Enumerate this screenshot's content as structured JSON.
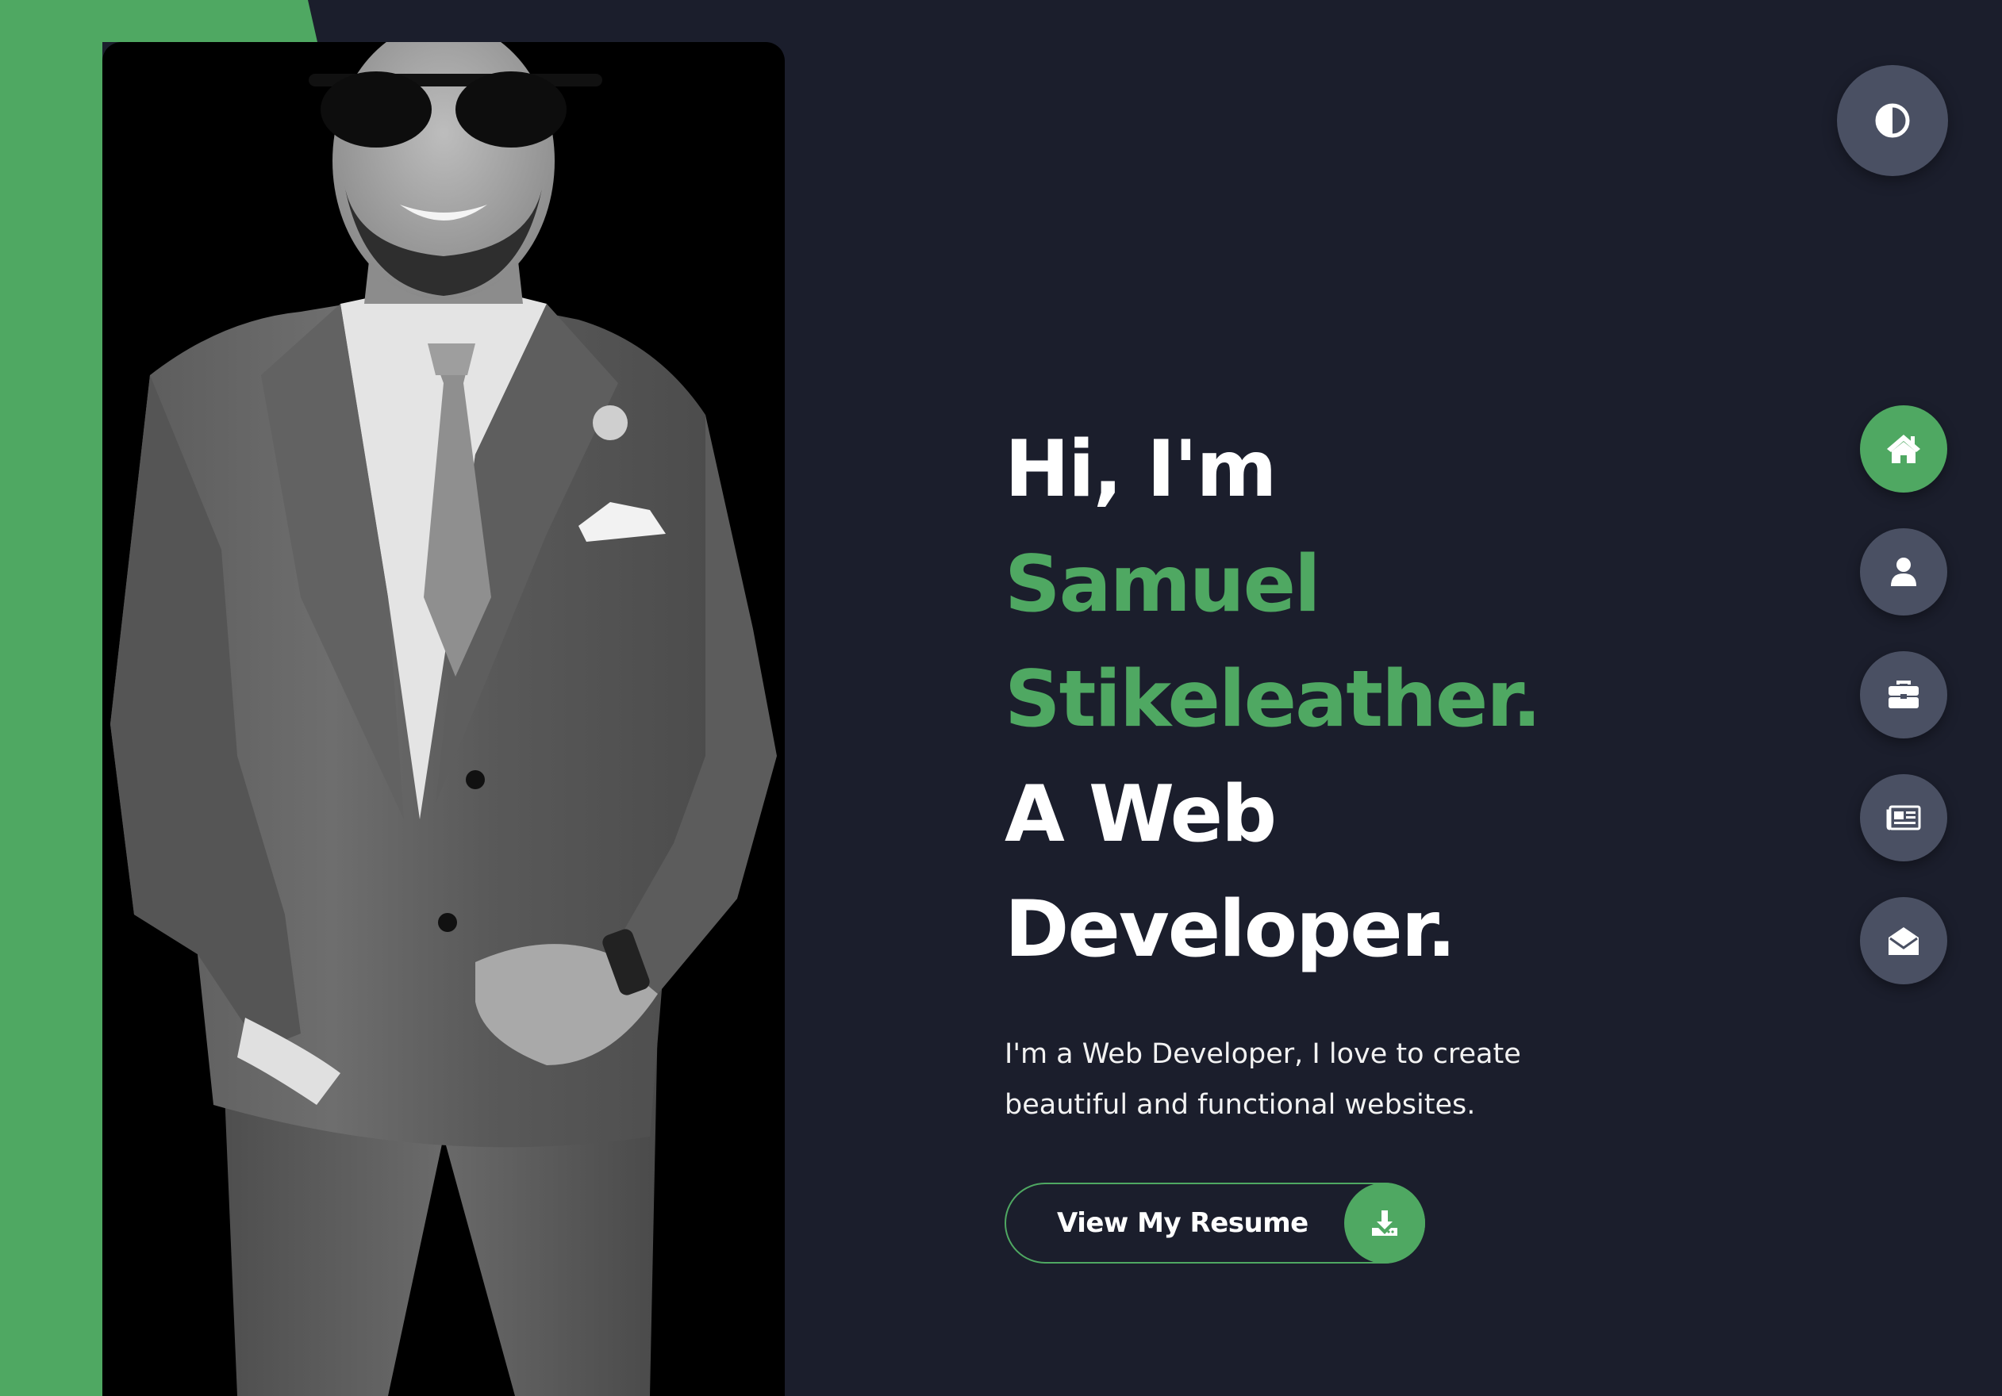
{
  "hero": {
    "greeting": "Hi, I'm",
    "name_first": "Samuel",
    "name_last": "Stikeleather.",
    "role_line1": "A Web",
    "role_line2": "Developer.",
    "intro_line1": "I'm a Web Developer, I love to create",
    "intro_line2": "beautiful and functional websites.",
    "resume_button_label": "View My Resume"
  },
  "icons": {
    "theme_toggle": "contrast-icon",
    "resume_download": "download-icon",
    "nav": [
      "home-icon",
      "user-icon",
      "briefcase-icon",
      "newspaper-icon",
      "envelope-open-icon"
    ]
  },
  "nav": {
    "items": [
      {
        "id": "home",
        "active": true
      },
      {
        "id": "about",
        "active": false
      },
      {
        "id": "portfolio",
        "active": false
      },
      {
        "id": "blog",
        "active": false
      },
      {
        "id": "contact",
        "active": false
      }
    ]
  },
  "colors": {
    "background": "#1b1e2c",
    "accent": "#4fa862",
    "button_gray": "#4a5063",
    "text": "#ffffff"
  }
}
